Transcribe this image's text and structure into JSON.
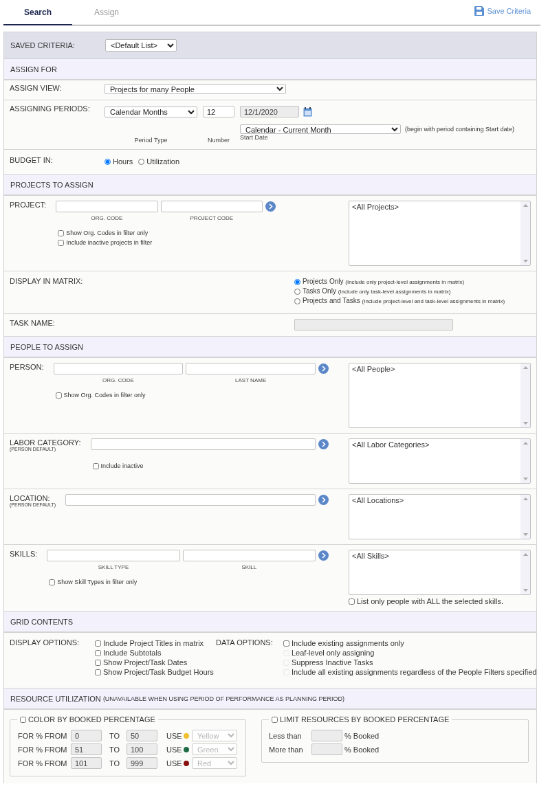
{
  "tabs": [
    {
      "label": "Search",
      "selected": true
    },
    {
      "label": "Assign",
      "selected": false
    }
  ],
  "save_link": "Save Criteria",
  "saved_criteria": {
    "label": "SAVED CRITERIA:",
    "value": "<Default List>"
  },
  "assign_for": {
    "title": "ASSIGN FOR",
    "assign_view": {
      "label": "ASSIGN VIEW:",
      "value": "Projects for many People"
    },
    "assigning_periods": {
      "label": "ASSIGNING PERIODS:",
      "period_type": {
        "value": "Calendar Months",
        "caption": "Period Type"
      },
      "number": {
        "value": "12",
        "caption": "Number"
      },
      "start_date": {
        "value": "12/1/2020",
        "caption": "Start Date"
      },
      "start_mode": "Calendar - Current Month",
      "note": "(begin with period containing Start date)"
    },
    "budget_in": {
      "label": "BUDGET IN:",
      "options": [
        {
          "label": "Hours",
          "selected": true
        },
        {
          "label": "Utilization",
          "selected": false
        }
      ]
    }
  },
  "projects": {
    "title": "PROJECTS TO ASSIGN",
    "filter": {
      "label": "PROJECT:",
      "captions": [
        "ORG. CODE",
        "PROJECT CODE"
      ],
      "checks": [
        {
          "label": "Show Org. Codes in filter only",
          "checked": false
        },
        {
          "label": "Include inactive projects in filter",
          "checked": false
        }
      ],
      "list_item": "<All Projects>"
    },
    "display": {
      "label": "DISPLAY IN MATRIX:",
      "options": [
        {
          "label": "Projects Only",
          "note": "(Include only project-level assignments in matrix)",
          "selected": true
        },
        {
          "label": "Tasks Only",
          "note": "(Include only task-level assignments in matrix)",
          "selected": false
        },
        {
          "label": "Projects and Tasks",
          "note": "(Include project-level and task-level assignments in matrix)",
          "selected": false
        }
      ]
    },
    "task_name": {
      "label": "TASK NAME:",
      "disabled": true
    }
  },
  "people": {
    "title": "PEOPLE TO ASSIGN",
    "filters": [
      {
        "label": "PERSON:",
        "captions": [
          "ORG. CODE",
          "LAST NAME"
        ],
        "checks": [
          {
            "label": "Show Org. Codes in filter only",
            "checked": false
          }
        ],
        "list_item": "<All People>"
      },
      {
        "label": "LABOR CATEGORY:",
        "sublabel": "(PERSON DEFAULT)",
        "checks": [
          {
            "label": "Include inactive",
            "checked": false
          }
        ],
        "list_item": "<All Labor Categories>"
      },
      {
        "label": "LOCATION:",
        "sublabel": "(PERSON DEFAULT)",
        "list_item": "<All Locations>"
      },
      {
        "label": "SKILLS:",
        "captions": [
          "SKILL TYPE",
          "SKILL"
        ],
        "checks": [
          {
            "label": "Show Skill Types in filter only",
            "checked": false
          }
        ],
        "list_item": "<All Skills>",
        "list_check": {
          "label": "List only people with ALL the selected skills.",
          "checked": false
        }
      }
    ]
  },
  "grid_contents": {
    "title": "GRID CONTENTS",
    "display_options": {
      "label": "DISPLAY OPTIONS:",
      "items": [
        {
          "label": "Include Project Titles in matrix",
          "checked": false,
          "disabled": false
        },
        {
          "label": "Include Subtotals",
          "checked": false,
          "disabled": false
        },
        {
          "label": "Show Project/Task Dates",
          "checked": false,
          "disabled": false
        },
        {
          "label": "Show Project/Task Budget Hours",
          "checked": false,
          "disabled": false
        }
      ]
    },
    "data_options": {
      "label": "DATA OPTIONS:",
      "items": [
        {
          "label": "Include existing assignments only",
          "checked": false,
          "disabled": false
        },
        {
          "label": "Leaf-level only assigning",
          "checked": false,
          "disabled": true
        },
        {
          "label": "Suppress Inactive Tasks",
          "checked": false,
          "disabled": true
        },
        {
          "label": "Include all existing assignments regardless of the People Filters specified",
          "checked": false,
          "disabled": true
        }
      ]
    }
  },
  "resource_utilization": {
    "title": "RESOURCE UTILIZATION",
    "note": "(UNAVAILABLE WHEN USING PERIOD OF PERFORMANCE AS PLANNING PERIOD)",
    "color_by": {
      "label": "COLOR BY BOOKED PERCENTAGE",
      "checked": false,
      "rows": [
        {
          "from_label": "FOR % FROM",
          "from": "0",
          "to_label": "TO",
          "to": "50",
          "use_label": "USE",
          "color": "#f0c030",
          "value": "Yellow"
        },
        {
          "from_label": "FOR % FROM",
          "from": "51",
          "to_label": "TO",
          "to": "100",
          "use_label": "USE",
          "color": "#1e6b45",
          "value": "Green"
        },
        {
          "from_label": "FOR % FROM",
          "from": "101",
          "to_label": "TO",
          "to": "999",
          "use_label": "USE",
          "color": "#8b1010",
          "value": "Red"
        }
      ]
    },
    "limit": {
      "label": "LIMIT RESOURCES BY BOOKED PERCENTAGE",
      "checked": false,
      "rows": [
        {
          "label": "Less than",
          "suffix": "% Booked"
        },
        {
          "label": "More than",
          "suffix": "% Booked"
        }
      ]
    }
  }
}
